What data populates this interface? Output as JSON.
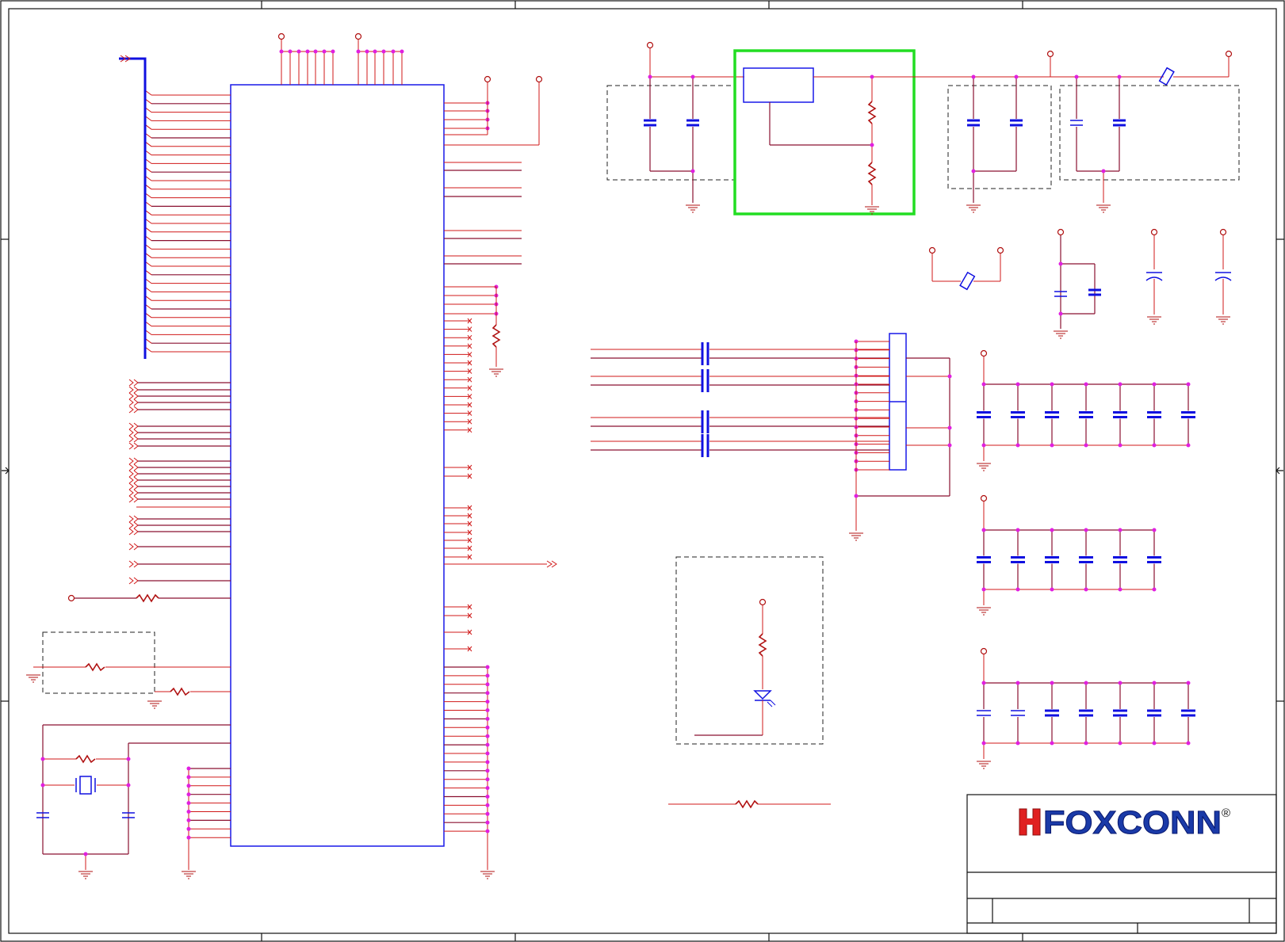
{
  "title_block": {
    "company_logo": "FOXCONN",
    "registered_mark": "®"
  },
  "colors": {
    "wire": "#d01818",
    "bus": "#1010e0",
    "junction": "#e020e0",
    "highlight": "#22dd22",
    "logo_red": "#e02020",
    "logo_blue": "#1a3aa8"
  }
}
